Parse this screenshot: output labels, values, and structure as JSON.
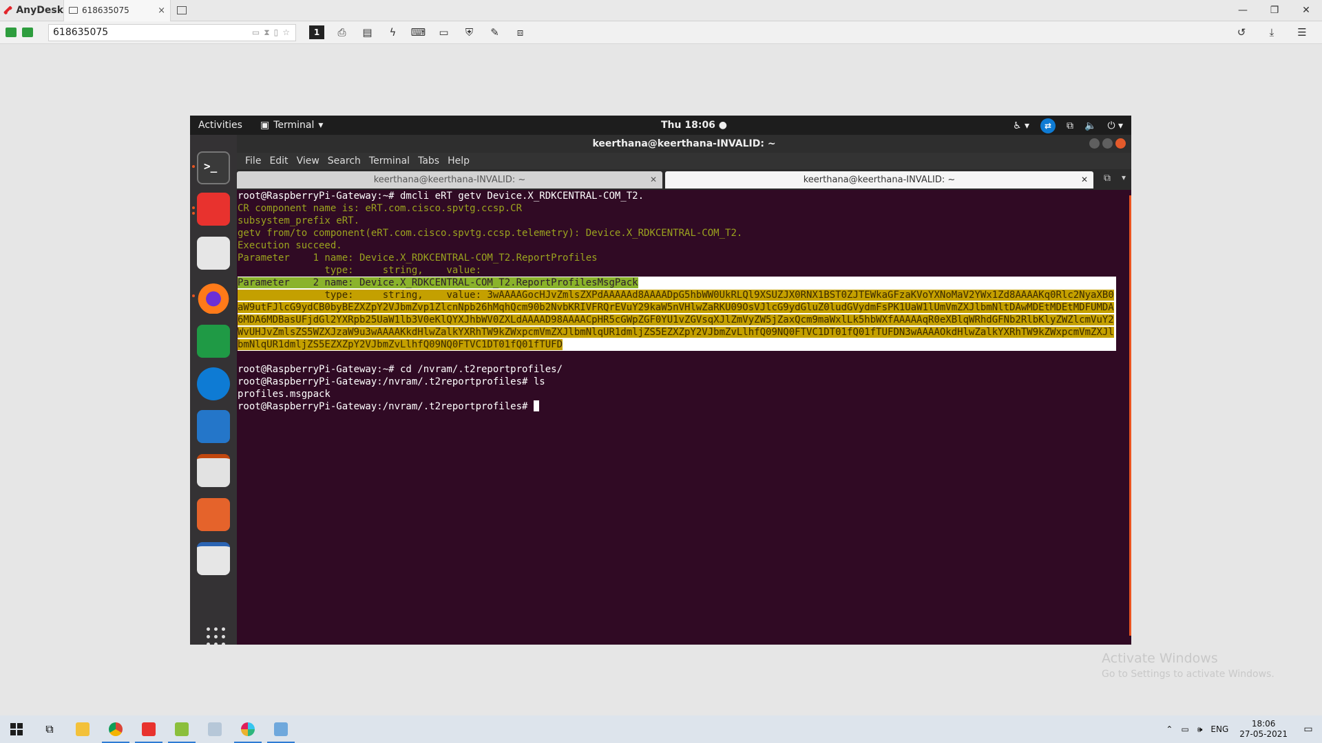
{
  "anydesk": {
    "app_name": "AnyDesk",
    "tab_label": "618635075",
    "tab_close": "×",
    "address": "618635075",
    "window_controls": {
      "minimize": "—",
      "restore": "❐",
      "close": "✕"
    },
    "toolbar_active": "1"
  },
  "remote": {
    "gnome": {
      "activities": "Activities",
      "app_menu": "Terminal",
      "clock": "Thu 18:06 ●"
    },
    "window_title": "keerthana@keerthana-INVALID: ~",
    "menu": [
      "File",
      "Edit",
      "View",
      "Search",
      "Terminal",
      "Tabs",
      "Help"
    ],
    "tabs": [
      {
        "label": "keerthana@keerthana-INVALID: ~"
      },
      {
        "label": "keerthana@keerthana-INVALID: ~"
      }
    ],
    "terminal": {
      "cmd1": "root@RaspberryPi-Gateway:~# dmcli eRT getv Device.X_RDKCENTRAL-COM_T2.",
      "out1": "CR component name is: eRT.com.cisco.spvtg.ccsp.CR",
      "out2": "subsystem_prefix eRT.",
      "out3": "getv from/to component(eRT.com.cisco.spvtg.ccsp.telemetry): Device.X_RDKCENTRAL-COM_T2.",
      "out4": "Execution succeed.",
      "out5": "Parameter    1 name: Device.X_RDKCENTRAL-COM_T2.ReportProfiles",
      "out6": "               type:     string,    value:",
      "out7": "Parameter    2 name: Device.X_RDKCENTRAL-COM_T2.ReportProfilesMsgPack",
      "out8_prefix": "               type:     string,    value: ",
      "msgpack_value": "3wAAAAGocHJvZmlsZXPdAAAAAd8AAAADpG5hbWW0UkRLQl9XSUZJX0RNX1BST0ZJTEWkaGFzaKVoYXNoMaV2YWx1Zd8AAAAKq0Rlc2NyaXB0aW9utFJlcG9ydCB0byBEZXZpY2VJbmZvp1ZlcnNpb26hMqhQcm90b2NvbKRIVFRQrEVuY29kaW5nVHlwZaRKU09OsVJlcG9ydGluZ0ludGVydmFsPK1UaW1lUmVmZXJlbmNltDAwMDEtMDEtMDFUMDA6MDA6MDBasUFjdGl2YXRpb25UaW1lb3V0eKlQYXJhbWV0ZXLdAAAAD98AAAACpHR5cGWpZGF0YU1vZGVsqXJlZmVyZW5jZaxQcm9maWxlLk5hbWXfAAAAAqR0eXBlqWRhdGFNb2RlbKlyZWZlcmVuY2WvUHJvZmlsZS5WZXJzaW9u3wAAAAKkdHlwZalkYXRhTW9kZWxpcmVmZXJlbmNlqUR1dmljZS5EZXZpY2VJbmZvLlhfQ09NQ0FTVC1DT01fQ01fTUFDN3wAAAAOkdHlwZalkYXRhTW9kZWxpcmVmZXJlbmNlqUR1dmljZS5EZXZpY2VJbmZvLlhfQ09NQ0FTVC1DT01fQ01fTUFD",
      "cmd2": "root@RaspberryPi-Gateway:~# cd /nvram/.t2reportprofiles/",
      "cmd3": "root@RaspberryPi-Gateway:/nvram/.t2reportprofiles# ls",
      "out9": "profiles.msgpack",
      "prompt": "root@RaspberryPi-Gateway:/nvram/.t2reportprofiles# "
    }
  },
  "watermark": {
    "title": "Activate Windows",
    "subtitle": "Go to Settings to activate Windows."
  },
  "taskbar": {
    "lang": "ENG",
    "time": "18:06",
    "date": "27-05-2021"
  }
}
